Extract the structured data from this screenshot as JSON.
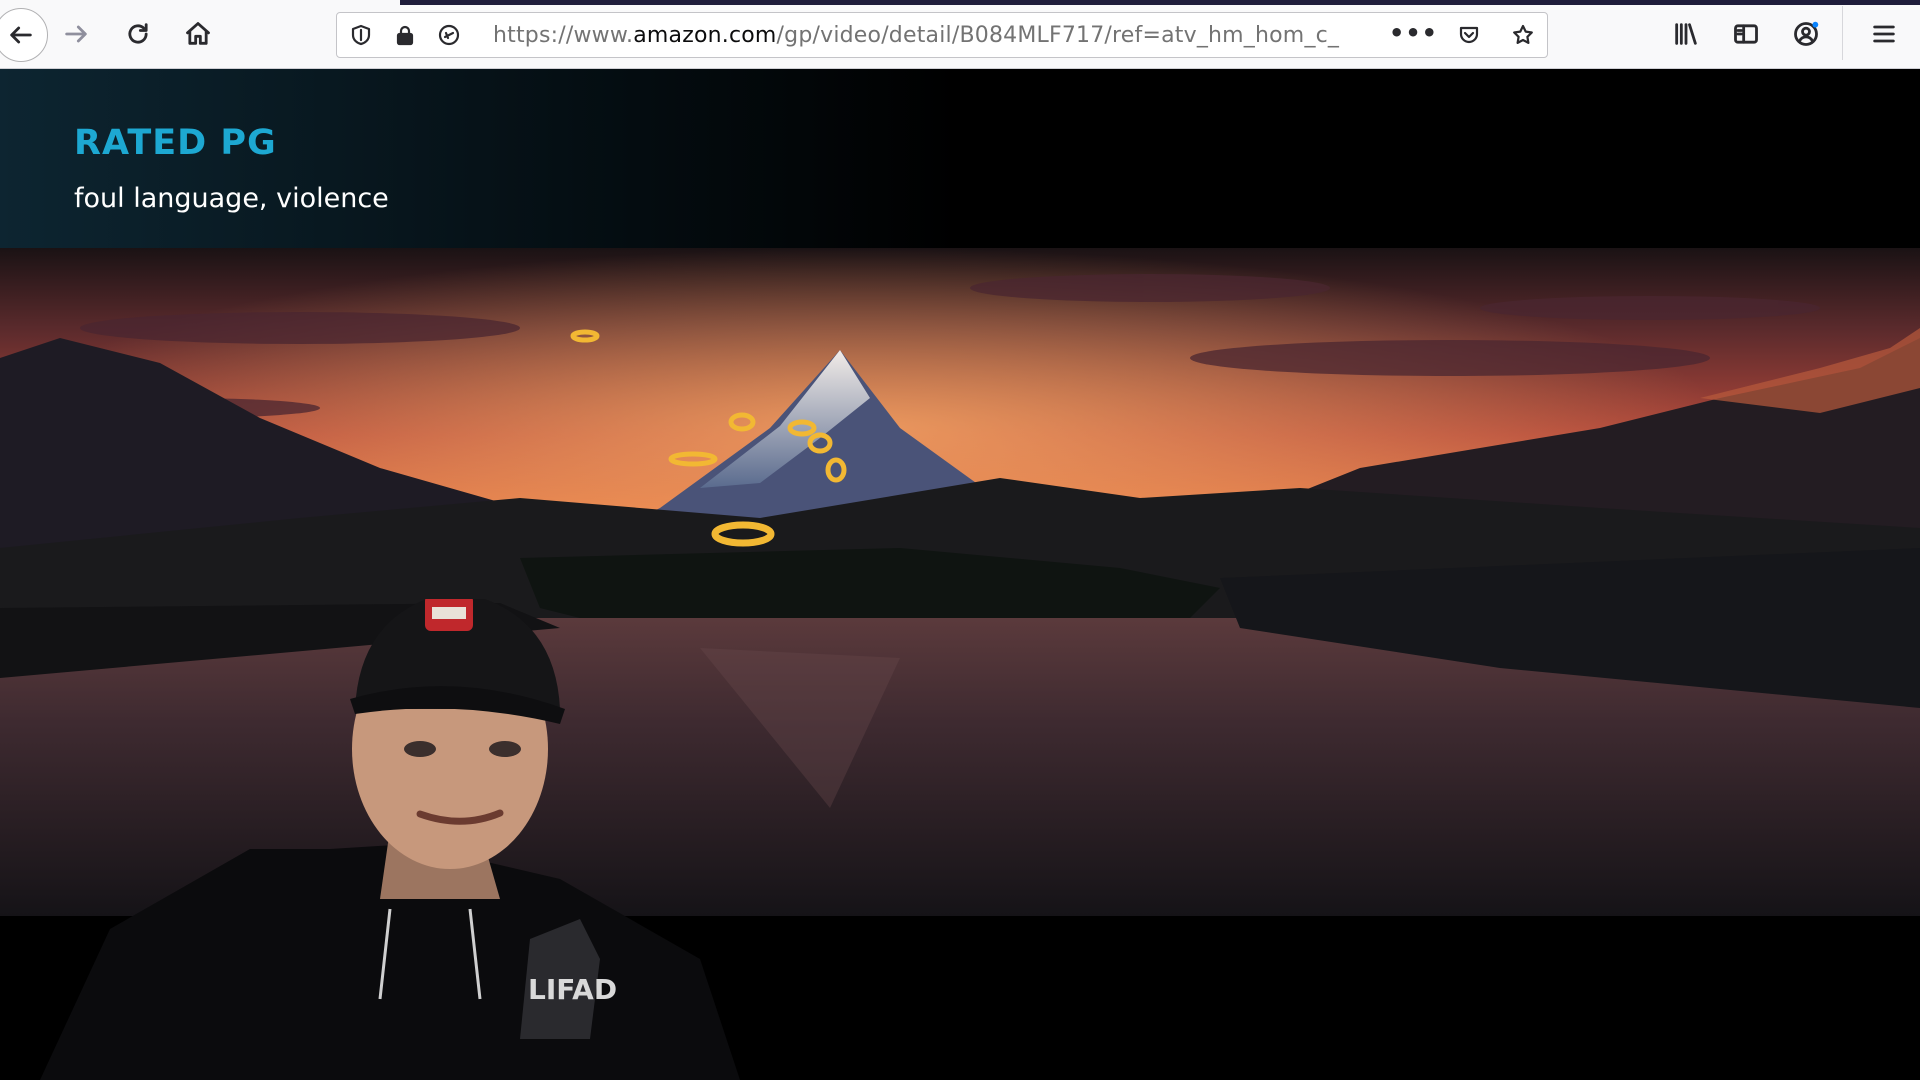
{
  "browser": {
    "url_prefix": "https://www.",
    "url_domain": "amazon.com",
    "url_path": "/gp/video/detail/B084MLF717/ref=atv_hm_hom_c_",
    "more_label": "•••"
  },
  "rating": {
    "title": "RATED PG",
    "descriptors": "foul language, violence"
  },
  "webcam": {
    "hoodie_text": "LIFAD"
  },
  "colors": {
    "rating_accent": "#1da8d2",
    "toolbar_bg": "#f9f9fa"
  },
  "icons": [
    "back-arrow-icon",
    "forward-arrow-icon",
    "reload-icon",
    "home-icon",
    "shield-icon",
    "lock-icon",
    "permissions-icon",
    "pocket-icon",
    "star-icon",
    "library-icon",
    "sidebar-icon",
    "account-icon",
    "menu-icon"
  ]
}
